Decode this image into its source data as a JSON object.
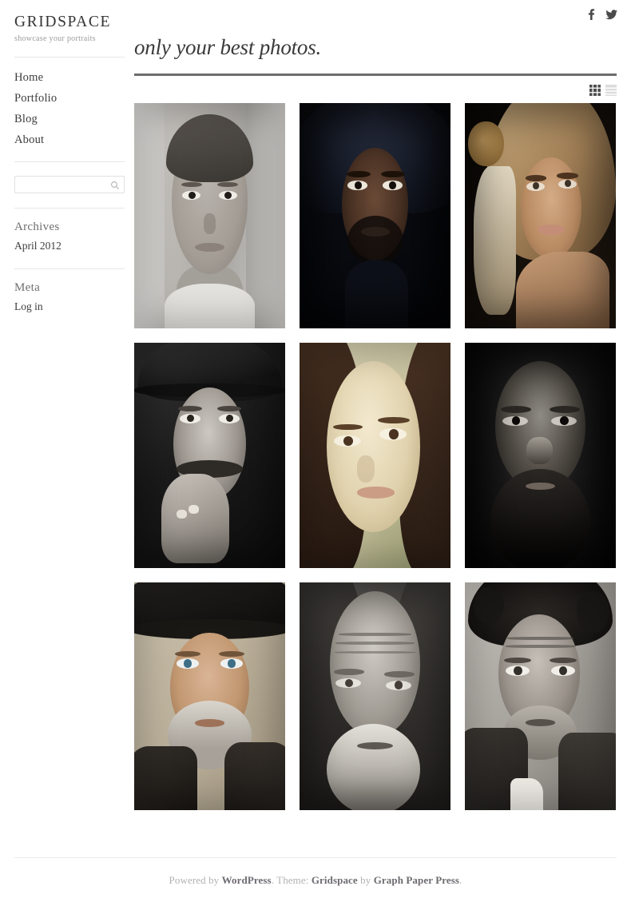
{
  "site": {
    "title": "GRIDSPACE",
    "description": "showcase your portraits"
  },
  "social": {
    "facebook_label": "f",
    "facebook_icon": "facebook-icon",
    "twitter_icon": "twitter-icon"
  },
  "nav": {
    "items": [
      {
        "label": "Home"
      },
      {
        "label": "Portfolio"
      },
      {
        "label": "Blog"
      },
      {
        "label": "About"
      }
    ]
  },
  "search": {
    "value": "",
    "placeholder": "",
    "icon": "search-icon"
  },
  "widgets": [
    {
      "title": "Archives",
      "items": [
        {
          "label": "April 2012"
        }
      ]
    },
    {
      "title": "Meta",
      "items": [
        {
          "label": "Log in"
        }
      ]
    }
  ],
  "main": {
    "page_title": "only your best photos.",
    "view_toggle": {
      "grid_icon": "grid-view-icon",
      "list_icon": "list-view-icon",
      "active": "grid"
    }
  },
  "gallery": {
    "items": [
      {
        "id": 1,
        "alt": "Black and white portrait of a freckled woman with slicked-back hair"
      },
      {
        "id": 2,
        "alt": "Dark portrait of a man wearing a hood"
      },
      {
        "id": 3,
        "alt": "Blonde woman with a flower in her hair on a dark background"
      },
      {
        "id": 4,
        "alt": "Black and white portrait of a man in a flat cap resting on his ringed hand"
      },
      {
        "id": 5,
        "alt": "Warm-toned close-up of a young woman with dark hair"
      },
      {
        "id": 6,
        "alt": "Very dark portrait of a bearded elderly man"
      },
      {
        "id": 7,
        "alt": "Bearded man wearing a black cowboy hat"
      },
      {
        "id": 8,
        "alt": "Elderly man in a hood with a white beard"
      },
      {
        "id": 9,
        "alt": "Weathered man with wild hair looking at the camera"
      }
    ]
  },
  "footer": {
    "prefix": "Powered by ",
    "wordpress": "WordPress",
    "middle": ". Theme: ",
    "theme": "Gridspace",
    "by": " by ",
    "author": "Graph Paper Press",
    "suffix": "."
  },
  "colors": {
    "text": "#3a3a3a",
    "muted": "#9b9b9b",
    "rule": "#e6e6e6",
    "title_rule": "#6c6c6c",
    "footer_text": "#b4b0b0",
    "footer_link": "#6e6a70"
  }
}
